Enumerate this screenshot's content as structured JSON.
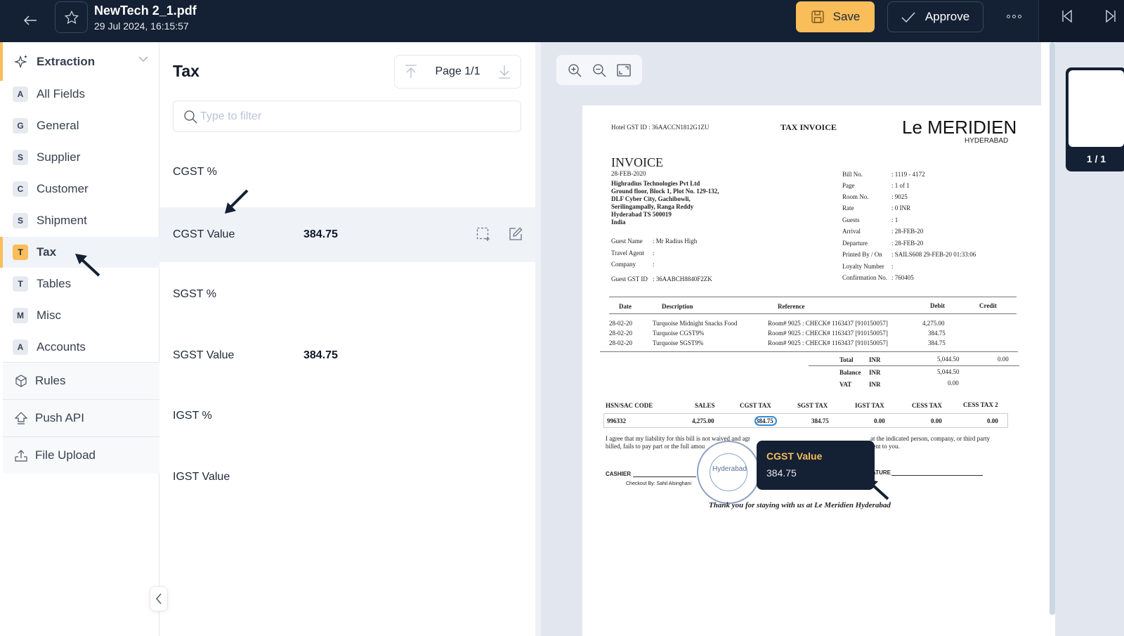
{
  "header": {
    "file_name": "NewTech 2_1.pdf",
    "timestamp": "29 Jul 2024, 16:15:57",
    "save_label": "Save",
    "approve_label": "Approve"
  },
  "sidebar": {
    "section_label": "Extraction",
    "items": [
      {
        "badge": "A",
        "label": "All Fields"
      },
      {
        "badge": "G",
        "label": "General"
      },
      {
        "badge": "S",
        "label": "Supplier"
      },
      {
        "badge": "C",
        "label": "Customer"
      },
      {
        "badge": "S",
        "label": "Shipment"
      },
      {
        "badge": "T",
        "label": "Tax"
      },
      {
        "badge": "T",
        "label": "Tables"
      },
      {
        "badge": "M",
        "label": "Misc"
      },
      {
        "badge": "A",
        "label": "Accounts"
      }
    ],
    "active_item": "Tax",
    "sections": [
      {
        "icon": "cube-icon",
        "label": "Rules"
      },
      {
        "icon": "upload-arrow-icon",
        "label": "Push API"
      },
      {
        "icon": "file-upload-icon",
        "label": "File Upload"
      }
    ]
  },
  "fields_panel": {
    "title": "Tax",
    "page_indicator": "Page 1/1",
    "filter_placeholder": "Type to filter",
    "filter_value": "",
    "fields": [
      {
        "label": "CGST %",
        "value": ""
      },
      {
        "label": "CGST Value",
        "value": "384.75",
        "selected": true
      },
      {
        "label": "SGST %",
        "value": ""
      },
      {
        "label": "SGST Value",
        "value": "384.75"
      },
      {
        "label": "IGST %",
        "value": ""
      },
      {
        "label": "IGST Value",
        "value": ""
      }
    ]
  },
  "viewer": {
    "thumbnail_label": "1 / 1",
    "tooltip": {
      "title": "CGST Value",
      "value": "384.75"
    }
  },
  "document": {
    "hotel_gst": "Hotel GST ID   :  36AACCN1812G1ZU",
    "tax_invoice": "TAX INVOICE",
    "brand": "Le MERIDIEN",
    "brand_sub": "HYDERABAD",
    "invoice_title": "INVOICE",
    "invoice_date": "28-FEB-2020",
    "address": [
      "Highradius Technologies Pvt Ltd",
      "Ground floor, Block 1, Plot No. 129-132,",
      "DLF Cyber City, Gachibowli,",
      "Serilingampally, Ranga Reddy",
      "Hyderabad TS 500019",
      "India"
    ],
    "guest_info": [
      {
        "k": "Guest Name",
        "v": ":  Mr Radius High"
      },
      {
        "k": "Travel Agent",
        "v": ":"
      },
      {
        "k": "Company",
        "v": ":"
      },
      {
        "k": "Guest GST ID",
        "v": ":  36AABCH8840F2ZK"
      }
    ],
    "bill_info": [
      {
        "k": "Bill No.",
        "v": ":  1119    - 4172"
      },
      {
        "k": "Page",
        "v": ":  1 of  1"
      },
      {
        "k": "Room No.",
        "v": ":  9025"
      },
      {
        "k": "Rate",
        "v": ":  0              INR"
      },
      {
        "k": "Guests",
        "v": ":  1"
      },
      {
        "k": "Arrival",
        "v": ":  28-FEB-20"
      },
      {
        "k": "Departure",
        "v": ":  28-FEB-20"
      },
      {
        "k": "Printed By / On",
        "v": ":  SAILS608 29-FEB-20 01:33:06"
      },
      {
        "k": "Loyalty Number",
        "v": ":"
      },
      {
        "k": "Confirmation No.",
        "v": ":  760405"
      }
    ],
    "table_headers": [
      "Date",
      "Description",
      "Reference",
      "Debit",
      "Credit"
    ],
    "table_rows": [
      [
        "28-02-20",
        "Turquoise Midnight Snacks Food",
        "Room# 9025 : CHECK# 1163437 [910150057]",
        "4,275.00",
        ""
      ],
      [
        "28-02-20",
        "Turquoise CGST9%",
        "Room# 9025 : CHECK# 1163437 [910150057]",
        "384.75",
        ""
      ],
      [
        "28-02-20",
        "Turquoise SGST9%",
        "Room# 9025 : CHECK# 1163437 [910150057]",
        "384.75",
        ""
      ]
    ],
    "totals": [
      {
        "k": "Total",
        "c": "INR",
        "debit": "5,044.50",
        "credit": "0.00"
      },
      {
        "k": "Balance",
        "c": "INR",
        "debit": "5,044.50",
        "credit": ""
      },
      {
        "k": "VAT",
        "c": "INR",
        "debit": "0.00",
        "credit": ""
      }
    ],
    "tax_headers": [
      "HSN/SAC CODE",
      "SALES",
      "CGST TAX",
      "SGST TAX",
      "IGST TAX",
      "CESS TAX",
      "CESS TAX 2"
    ],
    "tax_row": [
      "996332",
      "4,275.00",
      "384.75",
      "384.75",
      "0.00",
      "0.00",
      "0.00"
    ],
    "agreement": [
      "I agree that my liability for this bill is not waived and agr",
      "billed, fails to pay part or the full amou"
    ],
    "agreement_right": [
      "at the indicated person, company, or third party",
      "sent to you."
    ],
    "cashier": "CASHIER",
    "signature": "ATURE",
    "checkout": "Checkout By:    Sahil Alsinghani",
    "stamp_text": "Hyderabad",
    "thanks": "Thank you for staying with us at Le Meridien Hyderabad"
  }
}
